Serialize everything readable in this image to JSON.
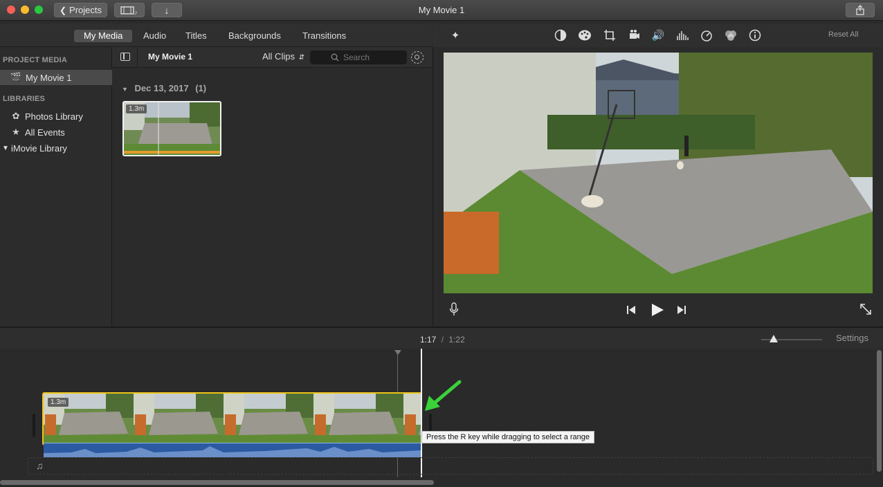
{
  "window": {
    "title": "My Movie 1",
    "projects_label": "Projects"
  },
  "tabs": [
    {
      "label": "My Media",
      "active": true
    },
    {
      "label": "Audio",
      "active": false
    },
    {
      "label": "Titles",
      "active": false
    },
    {
      "label": "Backgrounds",
      "active": false
    },
    {
      "label": "Transitions",
      "active": false
    }
  ],
  "sidebar": {
    "project_media_heading": "PROJECT MEDIA",
    "project_item": "My Movie 1",
    "libraries_heading": "LIBRARIES",
    "libraries": [
      {
        "label": "Photos Library",
        "icon": "flower-icon"
      },
      {
        "label": "All Events",
        "icon": "star-icon"
      },
      {
        "label": "iMovie Library",
        "icon": "disclosure-triangle-icon"
      }
    ]
  },
  "browser": {
    "title": "My Movie 1",
    "filter": "All Clips",
    "search_placeholder": "Search",
    "event_date": "Dec 13, 2017",
    "event_count": "(1)",
    "clip_duration": "1.3m"
  },
  "viewer": {
    "reset_label": "Reset All",
    "tools": [
      "magic-wand-icon",
      "color-balance-icon",
      "color-palette-icon",
      "crop-icon",
      "stabilization-icon",
      "volume-icon",
      "equalizer-icon",
      "speed-icon",
      "filter-icon",
      "info-icon"
    ]
  },
  "timeline": {
    "current_time": "1:17",
    "separator": "/",
    "total_time": "1:22",
    "settings_label": "Settings",
    "clip_duration": "1.3m",
    "tooltip": "Press the R key while dragging to select a range"
  },
  "colors": {
    "accent_yellow": "#f0c419",
    "audio_blue": "#2f5fa8",
    "arrow_green": "#3ad13a"
  }
}
